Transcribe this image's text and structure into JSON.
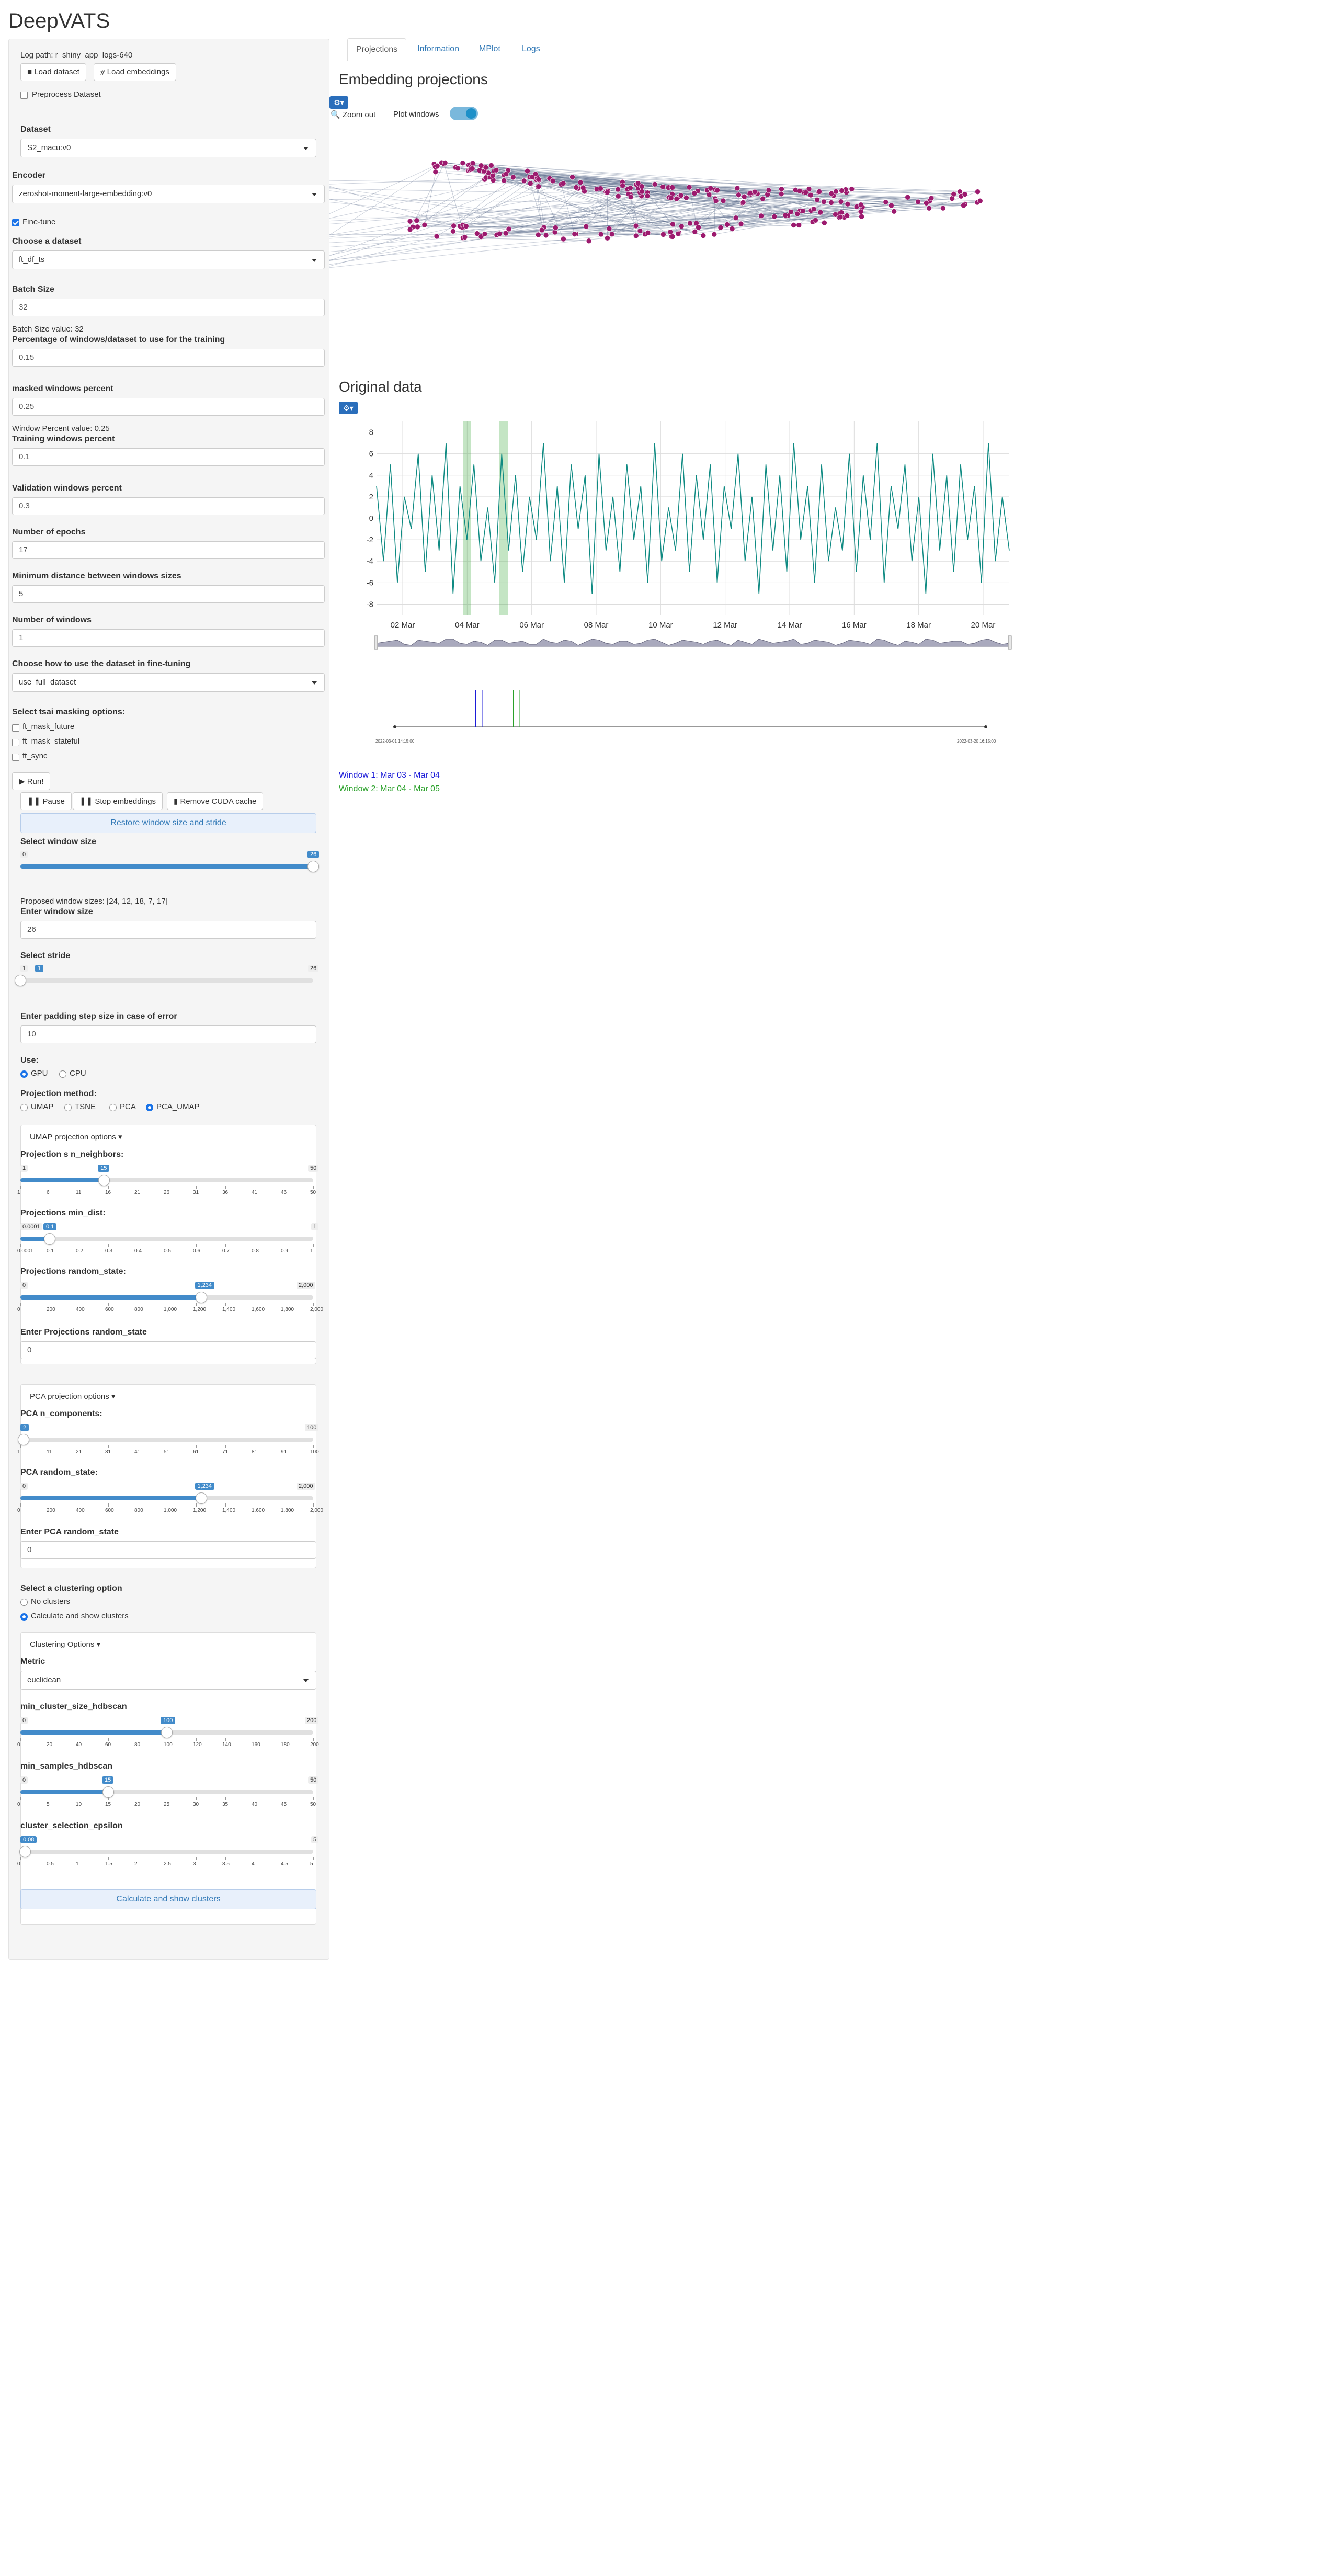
{
  "app": {
    "title": "DeepVATS"
  },
  "sidebar": {
    "log_path": "Log path: r_shiny_app_logs-640",
    "load_dataset": "Load dataset",
    "load_embeddings": "Load embeddings",
    "preprocess": "Preprocess Dataset",
    "dataset_label": "Dataset",
    "dataset_value": "S2_macu:v0",
    "encoder_label": "Encoder",
    "encoder_value": "zeroshot-moment-large-embedding:v0",
    "finetune": "Fine-tune",
    "choose_dataset_label": "Choose a dataset",
    "choose_dataset_value": "ft_df_ts",
    "batch_size_label": "Batch Size",
    "batch_size_value": "32",
    "batch_size_info": "Batch Size value: 32",
    "pct_windows_label": "Percentage of windows/dataset to use for the training",
    "pct_windows_value": "0.15",
    "masked_label": "masked windows percent",
    "masked_value": "0.25",
    "window_pct_info": "Window Percent value: 0.25",
    "training_label": "Training windows percent",
    "training_value": "0.1",
    "validation_label": "Validation windows percent",
    "validation_value": "0.3",
    "epochs_label": "Number of epochs",
    "epochs_value": "17",
    "min_dist_label": "Minimum distance between windows sizes",
    "min_dist_value": "5",
    "num_windows_label": "Number of windows",
    "num_windows_value": "1",
    "use_dataset_label": "Choose how to use the dataset in fine-tuning",
    "use_dataset_value": "use_full_dataset",
    "tsai_label": "Select tsai masking options:",
    "tsai_opts": [
      "ft_mask_future",
      "ft_mask_stateful",
      "ft_sync"
    ],
    "run": "Run!",
    "pause": "Pause",
    "stop": "Stop embeddings",
    "remove_cache": "Remove CUDA cache",
    "restore": "Restore window size and stride",
    "win_size_label": "Select window size",
    "win_size_min": "0",
    "win_size_val": "26",
    "win_size_level": 1.0,
    "proposed": "Proposed window sizes: [24, 12, 18, 7, 17]",
    "enter_win_label": "Enter window size",
    "enter_win_value": "26",
    "stride_label": "Select stride",
    "stride_min": "1",
    "stride_val": "1",
    "stride_max": "26",
    "stride_level": 0.0,
    "padding_label": "Enter padding step size in case of error",
    "padding_value": "10",
    "use_label": "Use:",
    "use_opts": [
      "GPU",
      "CPU"
    ],
    "proj_method_label": "Projection method:",
    "proj_opts": [
      "UMAP",
      "TSNE",
      "PCA",
      "PCA_UMAP"
    ],
    "umap_title": "UMAP projection options",
    "nn_label": "Projection s n_neighbors:",
    "nn_min": "1",
    "nn_val": "15",
    "nn_max": "50",
    "nn_level": 0.286,
    "nn_ticks": [
      "1",
      "6",
      "11",
      "16",
      "21",
      "26",
      "31",
      "36",
      "41",
      "46",
      "50"
    ],
    "md_label": "Projections min_dist:",
    "md_min": "0.0001",
    "md_val": "0.1",
    "md_max": "1",
    "md_level": 0.1,
    "md_ticks": [
      "0.0001",
      "0.1",
      "0.2",
      "0.3",
      "0.4",
      "0.5",
      "0.6",
      "0.7",
      "0.8",
      "0.9",
      "1"
    ],
    "rs_label": "Projections random_state:",
    "rs_min": "0",
    "rs_val": "1,234",
    "rs_max": "2,000",
    "rs_level": 0.617,
    "rs_ticks": [
      "0",
      "200",
      "400",
      "600",
      "800",
      "1,000",
      "1,200",
      "1,400",
      "1,600",
      "1,800",
      "2,000"
    ],
    "rs_enter_label": "Enter Projections random_state",
    "rs_enter_value": "0",
    "pca_title": "PCA projection options",
    "pcan_label": "PCA n_components:",
    "pcan_min": "1",
    "pcan_val": "2",
    "pcan_max": "100",
    "pcan_level": 0.01,
    "pcan_ticks": [
      "1",
      "11",
      "21",
      "31",
      "41",
      "51",
      "61",
      "71",
      "81",
      "91",
      "100"
    ],
    "pcars_label": "PCA random_state:",
    "pcars_min": "0",
    "pcars_val": "1,234",
    "pcars_max": "2,000",
    "pcars_level": 0.617,
    "pcars_ticks": [
      "0",
      "200",
      "400",
      "600",
      "800",
      "1,000",
      "1,200",
      "1,400",
      "1,600",
      "1,800",
      "2,000"
    ],
    "pcars_enter_label": "Enter PCA random_state",
    "pcars_enter_value": "0",
    "cluster_label": "Select a clustering option",
    "cluster_opts": [
      "No clusters",
      "Calculate and show clusters"
    ],
    "cluster_options_title": "Clustering Options",
    "metric_label": "Metric",
    "metric_value": "euclidean",
    "mcs_label": "min_cluster_size_hdbscan",
    "mcs_min": "0",
    "mcs_val": "100",
    "mcs_max": "200",
    "mcs_level": 0.5,
    "mcs_ticks": [
      "0",
      "20",
      "40",
      "60",
      "80",
      "100",
      "120",
      "140",
      "160",
      "180",
      "200"
    ],
    "ms_label": "min_samples_hdbscan",
    "ms_min": "0",
    "ms_val": "15",
    "ms_max": "50",
    "ms_level": 0.3,
    "ms_ticks": [
      "0",
      "5",
      "10",
      "15",
      "20",
      "25",
      "30",
      "35",
      "40",
      "45",
      "50"
    ],
    "cse_label": "cluster_selection_epsilon",
    "cse_min": "0.01",
    "cse_val": "0.08",
    "cse_max": "5",
    "cse_level": 0.016,
    "cse_ticks": [
      "0",
      "0.5",
      "1",
      "1.5",
      "2",
      "2.5",
      "3",
      "3.5",
      "4",
      "4.5",
      "5"
    ],
    "calc_button": "Calculate and show clusters"
  },
  "main": {
    "tabs": [
      "Projections",
      "Information",
      "MPlot",
      "Logs"
    ],
    "embedding_title": "Embedding projections",
    "zoom_out": "Zoom out",
    "plot_windows": "Plot windows",
    "original_title": "Original data",
    "window1": "Window 1: Mar 03 - Mar 04",
    "window2": "Window 2: Mar 04 - Mar 05",
    "timeline_left": "2022-03-01 14:15:00",
    "timeline_right": "2022-03-20 16:15:00"
  },
  "chart_data": {
    "type": "line",
    "ylabel": "",
    "xlabel": "",
    "x_ticks": [
      "02 Mar",
      "04 Mar",
      "06 Mar",
      "08 Mar",
      "10 Mar",
      "12 Mar",
      "14 Mar",
      "16 Mar",
      "18 Mar",
      "20 Mar"
    ],
    "y_ticks": [
      "8",
      "6",
      "4",
      "2",
      "0",
      "-2",
      "-4",
      "-6",
      "-8"
    ],
    "ylim": [
      -9,
      9
    ],
    "x_range": [
      "2022-03-01 14:15:00",
      "2022-03-20 16:15:00"
    ],
    "series": [
      {
        "values": [
          3,
          -4,
          5,
          -6,
          2,
          -1,
          6,
          -5,
          4,
          -3,
          7,
          -7,
          3,
          -2,
          5,
          -4,
          1,
          -6,
          6,
          -3,
          4,
          -5,
          2,
          -2,
          7,
          -4,
          3,
          -6,
          5,
          -1,
          4,
          -7,
          6,
          -3,
          2,
          -5,
          5,
          -2,
          3,
          -6,
          7,
          -4,
          1,
          -3,
          6,
          -5,
          4,
          -2,
          5,
          -6,
          3,
          -1,
          6,
          -4,
          2,
          -7,
          5,
          -3,
          4,
          -5,
          7,
          -2,
          3,
          -6,
          5,
          -4,
          1,
          -3,
          6,
          -5,
          4,
          -2,
          7,
          -6,
          3,
          -1,
          5,
          -4,
          2,
          -7,
          6,
          -3,
          4,
          -5,
          5,
          -2,
          3,
          -6,
          7,
          -4,
          2,
          -3
        ]
      }
    ],
    "highlight_windows": [
      "Mar 03 - Mar 04",
      "Mar 04 - Mar 05"
    ],
    "color": "#0e8a82"
  }
}
